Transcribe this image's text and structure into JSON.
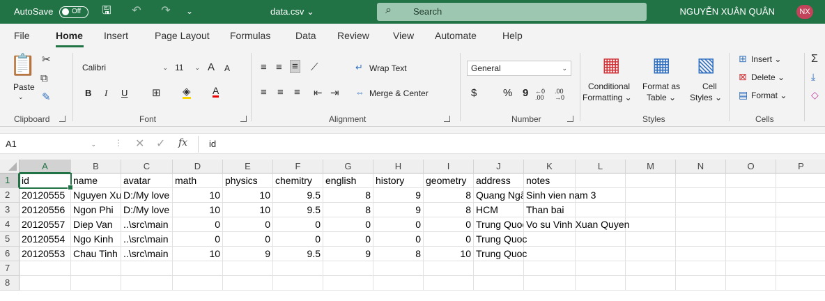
{
  "titlebar": {
    "autosave_label": "AutoSave",
    "autosave_state": "Off",
    "doc_title": "data.csv ⌄",
    "search_placeholder": "Search",
    "user_name": "NGUYỄN XUÂN QUÂN",
    "user_initials": "NX",
    "accent_color": "#217346"
  },
  "tabs": [
    "File",
    "Home",
    "Insert",
    "Page Layout",
    "Formulas",
    "Data",
    "Review",
    "View",
    "Automate",
    "Help"
  ],
  "active_tab": "Home",
  "ribbon": {
    "clipboard": {
      "paste": "Paste",
      "label": "Clipboard"
    },
    "font": {
      "name": "Calibri",
      "size": "11",
      "label": "Font",
      "bold": "B",
      "italic": "I",
      "underline": "U",
      "grow": "A",
      "shrink": "A"
    },
    "alignment": {
      "wrap": "Wrap Text",
      "merge": "Merge & Center",
      "label": "Alignment"
    },
    "number": {
      "format": "General",
      "currency": "$",
      "percent": "%",
      "comma": "9",
      "inc_decimal": "←0 .00",
      "dec_decimal": ".00 →0",
      "label": "Number"
    },
    "styles": {
      "conditional_1": "Conditional",
      "conditional_2": "Formatting ⌄",
      "table_1": "Format as",
      "table_2": "Table ⌄",
      "cell_1": "Cell",
      "cell_2": "Styles ⌄",
      "label": "Styles"
    },
    "cells": {
      "insert": "Insert ⌄",
      "delete": "Delete ⌄",
      "format": "Format ⌄",
      "label": "Cells"
    }
  },
  "formula_bar": {
    "name_box": "A1",
    "fx": "fx",
    "content": "id"
  },
  "sheet": {
    "columns": [
      "A",
      "B",
      "C",
      "D",
      "E",
      "F",
      "G",
      "H",
      "I",
      "J",
      "K",
      "L",
      "M",
      "N",
      "O",
      "P"
    ],
    "row_numbers": [
      "1",
      "2",
      "3",
      "4",
      "5",
      "6",
      "7",
      "8"
    ],
    "header": [
      "id",
      "name",
      "avatar",
      "math",
      "physics",
      "chemitry",
      "english",
      "history",
      "geometry",
      "address",
      "notes"
    ],
    "rows": [
      [
        "20120555",
        "Nguyen Xuân Quân",
        "D:/My love",
        "10",
        "10",
        "9.5",
        "8",
        "9",
        "8",
        "Quang Ngãi",
        "Sinh vien nam 3"
      ],
      [
        "20120556",
        "Ngon Phi",
        "D:/My love",
        "10",
        "10",
        "9.5",
        "8",
        "9",
        "8",
        "HCM",
        "Than bai"
      ],
      [
        "20120557",
        "Diep Van",
        "..\\src\\main",
        "0",
        "0",
        "0",
        "0",
        "0",
        "0",
        "Trung Quoc",
        "Vo su Vinh Xuan Quyen"
      ],
      [
        "20120554",
        "Ngo Kinh",
        "..\\src\\main",
        "0",
        "0",
        "0",
        "0",
        "0",
        "0",
        "Trung Quoc",
        ""
      ],
      [
        "20120553",
        "Chau Tinh",
        "..\\src\\main",
        "10",
        "9",
        "9.5",
        "9",
        "8",
        "10",
        "Trung Quoc",
        ""
      ]
    ],
    "active_cell": "A1"
  }
}
